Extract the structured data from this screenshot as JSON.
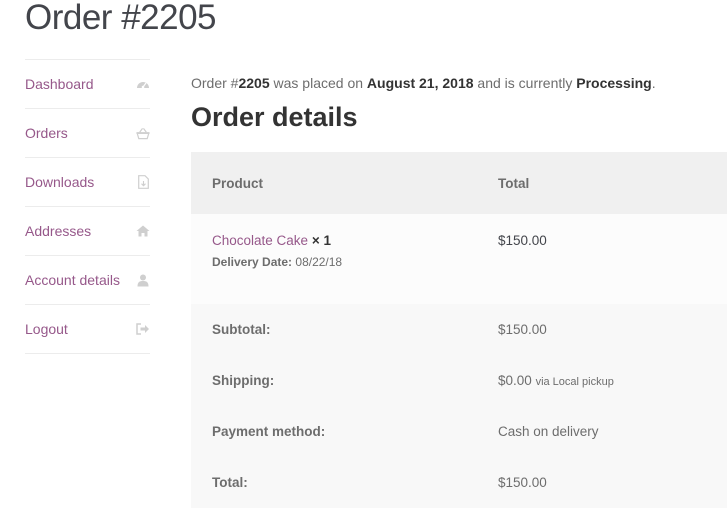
{
  "page": {
    "title": "Order #2205"
  },
  "nav": {
    "items": [
      {
        "label": "Dashboard",
        "icon": "dashboard-icon"
      },
      {
        "label": "Orders",
        "icon": "basket-icon"
      },
      {
        "label": "Downloads",
        "icon": "file-download-icon"
      },
      {
        "label": "Addresses",
        "icon": "home-icon"
      },
      {
        "label": "Account details",
        "icon": "user-icon"
      },
      {
        "label": "Logout",
        "icon": "sign-out-icon"
      }
    ]
  },
  "intro": {
    "prefix": "Order #",
    "order_number": "2205",
    "placed_on_text": " was placed on ",
    "date": "August 21, 2018",
    "status_text": " and is currently ",
    "status": "Processing",
    "suffix": "."
  },
  "details": {
    "heading": "Order details",
    "columns": {
      "product": "Product",
      "total": "Total"
    },
    "item": {
      "name": "Chocolate Cake",
      "quantity": " × 1",
      "meta_key": "Delivery Date:",
      "meta_value": "08/22/18",
      "total": "$150.00"
    },
    "totals": [
      {
        "label": "Subtotal:",
        "value": "$150.00",
        "note": ""
      },
      {
        "label": "Shipping:",
        "value": "$0.00",
        "note": "via Local pickup"
      },
      {
        "label": "Payment method:",
        "value": "Cash on delivery",
        "note": ""
      },
      {
        "label": "Total:",
        "value": "$150.00",
        "note": ""
      }
    ]
  },
  "colors": {
    "link": "#96588a",
    "text": "#6d6d6d",
    "heading": "#333333",
    "table_header_bg": "#f0f0f0",
    "table_row_bg": "#f8f8f8"
  }
}
